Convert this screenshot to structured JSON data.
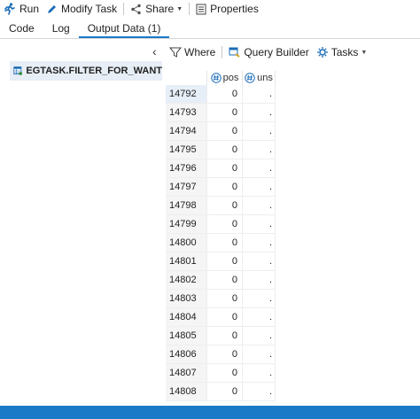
{
  "toolbar": {
    "run_label": "Run",
    "modify_task_label": "Modify Task",
    "share_label": "Share",
    "properties_label": "Properties"
  },
  "tabs": [
    {
      "label": "Code"
    },
    {
      "label": "Log"
    },
    {
      "label": "Output Data (1)",
      "active": true
    }
  ],
  "dataset": {
    "label": "EGTASK.FILTER_FOR_WANT"
  },
  "data_toolbar": {
    "where_label": "Where",
    "query_builder_label": "Query Builder",
    "tasks_label": "Tasks"
  },
  "table": {
    "columns": [
      {
        "label": "pos"
      },
      {
        "label": "uns"
      }
    ],
    "rows": [
      {
        "id": "14792",
        "pos": "0",
        "uns": "."
      },
      {
        "id": "14793",
        "pos": "0",
        "uns": "."
      },
      {
        "id": "14794",
        "pos": "0",
        "uns": "."
      },
      {
        "id": "14795",
        "pos": "0",
        "uns": "."
      },
      {
        "id": "14796",
        "pos": "0",
        "uns": "."
      },
      {
        "id": "14797",
        "pos": "0",
        "uns": "."
      },
      {
        "id": "14798",
        "pos": "0",
        "uns": "."
      },
      {
        "id": "14799",
        "pos": "0",
        "uns": "."
      },
      {
        "id": "14800",
        "pos": "0",
        "uns": "."
      },
      {
        "id": "14801",
        "pos": "0",
        "uns": "."
      },
      {
        "id": "14802",
        "pos": "0",
        "uns": "."
      },
      {
        "id": "14803",
        "pos": "0",
        "uns": "."
      },
      {
        "id": "14804",
        "pos": "0",
        "uns": "."
      },
      {
        "id": "14805",
        "pos": "0",
        "uns": "."
      },
      {
        "id": "14806",
        "pos": "0",
        "uns": "."
      },
      {
        "id": "14807",
        "pos": "0",
        "uns": "."
      },
      {
        "id": "14808",
        "pos": "0",
        "uns": "."
      }
    ]
  },
  "icons": {
    "run": "running-person-icon",
    "modify_task": "pencil-icon",
    "share": "share-icon",
    "properties": "properties-icon",
    "collapse": "chevron-left-icon",
    "dataset": "dataset-table-icon",
    "where": "filter-icon",
    "query_builder": "query-builder-icon",
    "tasks": "tasks-gear-icon",
    "numeric_column": "numeric-column-icon"
  },
  "colors": {
    "accent": "#1a7ac8",
    "selection": "#e6eef7"
  }
}
